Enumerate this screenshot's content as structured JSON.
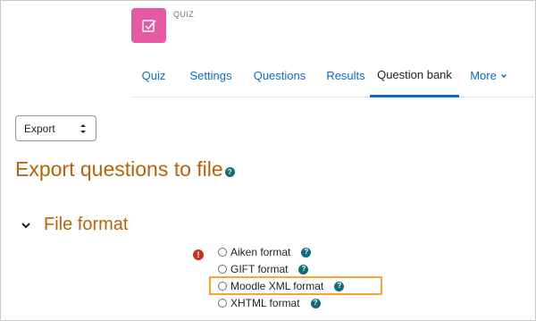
{
  "header": {
    "activity_type": "QUIZ",
    "icon": "quiz-checkbox-icon",
    "icon_bg": "#e659a3"
  },
  "nav": {
    "tabs": [
      {
        "label": "Quiz"
      },
      {
        "label": "Settings"
      },
      {
        "label": "Questions"
      },
      {
        "label": "Results"
      },
      {
        "label": "Question bank",
        "active": true
      },
      {
        "label": "More"
      }
    ]
  },
  "selector": {
    "value": "Export"
  },
  "page": {
    "title": "Export questions to file"
  },
  "section": {
    "title": "File format"
  },
  "formats": [
    {
      "label": "Aiken format"
    },
    {
      "label": "GIFT format"
    },
    {
      "label": "Moodle XML format",
      "highlighted": true
    },
    {
      "label": "XHTML format"
    }
  ],
  "colors": {
    "heading": "#b5630d",
    "link": "#0f6cbf",
    "help": "#0f6c78",
    "required": "#ca3120",
    "highlight": "#f7a531"
  }
}
